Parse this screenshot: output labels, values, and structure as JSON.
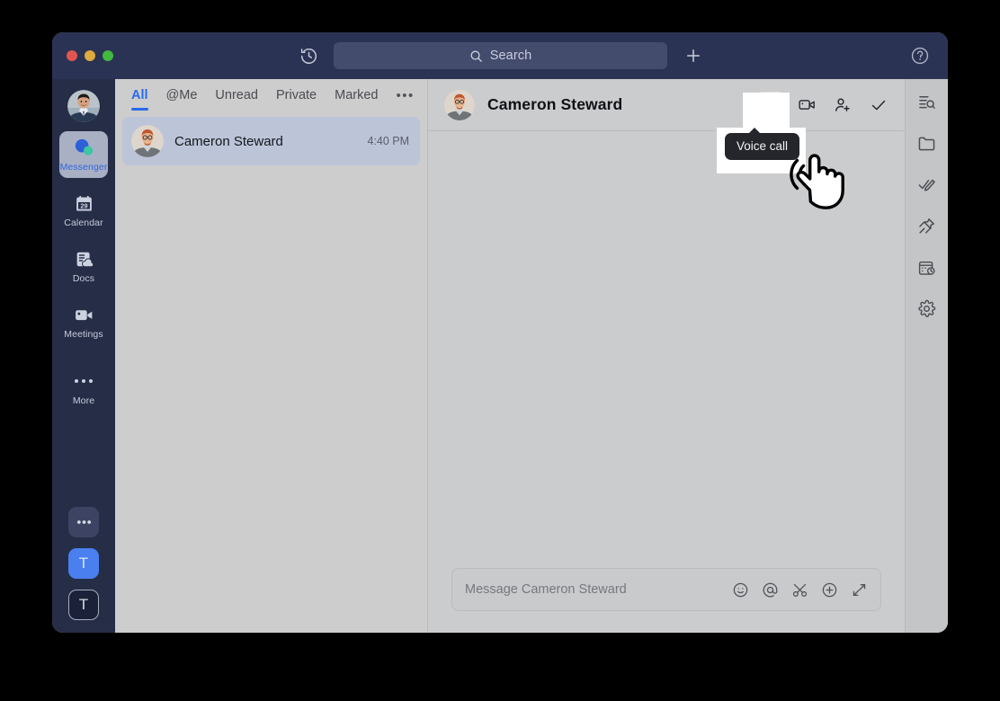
{
  "window": {
    "traffic_lights": [
      "close",
      "minimize",
      "maximize"
    ],
    "colors": {
      "titlebar": "#2b3354",
      "rail": "#262d47",
      "accent_blue": "#2a6aea",
      "list_bg": "#cdcdcd",
      "chat_bg": "#cbcccd",
      "selected_row": "#bcc4d8",
      "tooltip_bg": "#24262b"
    }
  },
  "topbar": {
    "history_icon": "clock-history-icon",
    "search": {
      "placeholder": "Search",
      "icon": "search-icon"
    },
    "add_button": {
      "label": "+",
      "icon": "plus-icon"
    },
    "help_button": {
      "label": "?",
      "icon": "help-circle-icon"
    }
  },
  "sidebar": {
    "avatar": "user-avatar",
    "items": [
      {
        "label": "Messenger",
        "icon": "messenger-icon",
        "active": true
      },
      {
        "label": "Calendar",
        "icon": "calendar-icon",
        "active": false,
        "day": "29"
      },
      {
        "label": "Docs",
        "icon": "docs-icon",
        "active": false
      },
      {
        "label": "Meetings",
        "icon": "video-camera-icon",
        "active": false
      },
      {
        "label": "More",
        "icon": "ellipsis-icon",
        "active": false
      }
    ],
    "bottom": [
      {
        "label": "",
        "icon": "ellipsis-icon",
        "name": "more-apps-button"
      },
      {
        "label": "T",
        "icon": "",
        "name": "workspace-badge-blue"
      },
      {
        "label": "T",
        "icon": "",
        "name": "workspace-badge-dark"
      }
    ]
  },
  "conversation_list": {
    "tabs": [
      {
        "label": "All",
        "active": true
      },
      {
        "label": "@Me",
        "active": false
      },
      {
        "label": "Unread",
        "active": false
      },
      {
        "label": "Private",
        "active": false
      },
      {
        "label": "Marked",
        "active": false
      },
      {
        "label": "•••",
        "active": false
      }
    ],
    "rows": [
      {
        "name": "Cameron Steward",
        "time": "4:40 PM",
        "selected": true
      }
    ]
  },
  "chat": {
    "title": "Cameron Steward",
    "avatar": "cameron-avatar",
    "header_actions": [
      {
        "name": "voice-call-button",
        "icon": "phone-icon",
        "highlighted": true
      },
      {
        "name": "video-call-button",
        "icon": "video-camera-icon",
        "highlighted": false
      },
      {
        "name": "add-member-button",
        "icon": "person-add-icon",
        "highlighted": false
      },
      {
        "name": "mark-done-button",
        "icon": "check-icon",
        "highlighted": false
      }
    ],
    "composer": {
      "placeholder": "Message Cameron Steward",
      "icons": [
        {
          "name": "emoji-button",
          "icon": "smiley-icon"
        },
        {
          "name": "mention-button",
          "icon": "at-sign-icon"
        },
        {
          "name": "screenshot-button",
          "icon": "scissors-icon"
        },
        {
          "name": "attach-more-button",
          "icon": "plus-circle-icon"
        },
        {
          "name": "expand-composer-button",
          "icon": "expand-arrows-icon"
        }
      ]
    }
  },
  "right_rail": [
    {
      "name": "search-messages-button",
      "icon": "list-search-icon"
    },
    {
      "name": "files-button",
      "icon": "folder-icon"
    },
    {
      "name": "tasks-button",
      "icon": "check-pen-icon"
    },
    {
      "name": "pinned-button",
      "icon": "pin-icon"
    },
    {
      "name": "schedule-button",
      "icon": "calendar-clock-icon"
    },
    {
      "name": "settings-button",
      "icon": "gear-icon"
    }
  ],
  "tooltip": {
    "text": "Voice call"
  }
}
